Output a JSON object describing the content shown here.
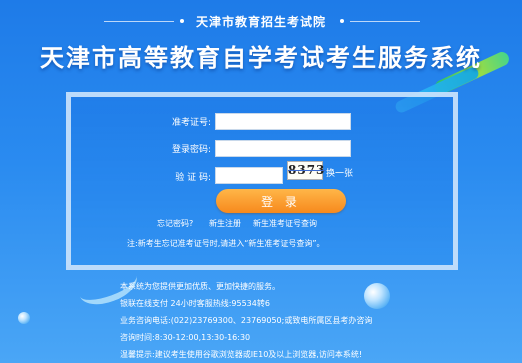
{
  "header": {
    "subtitle": "天津市教育招生考试院",
    "title": "天津市高等教育自学考试考生服务系统"
  },
  "login": {
    "exam_id_label": "准考证号:",
    "exam_id_value": "",
    "password_label": "登录密码:",
    "password_value": "",
    "captcha_label": "验 证 码:",
    "captcha_value": "",
    "captcha_code": "8373",
    "refresh_label": "换一张",
    "login_button": "登 录",
    "forgot_password": "忘记密码?",
    "register": "新生注册",
    "query_exam_id": "新生准考证号查询",
    "note": "注:新考生忘记准考证号时,请进入“新生准考证号查询”。"
  },
  "info": {
    "line1": "本系统为您提供更加优质、更加快捷的服务。",
    "line2": "银联在线支付 24小时客服热线:95534转6",
    "line3": "业务咨询电话:(022)23769300、23769050;或致电所属区县考办咨询",
    "line4": "咨询时间:8:30-12:00,13:30-16:30",
    "line5": "温馨提示:建议考生使用谷歌浏览器或IE10及以上浏览器,访问本系统!"
  },
  "colors": {
    "background": "#2a8bf0",
    "button": "#f7891d"
  }
}
